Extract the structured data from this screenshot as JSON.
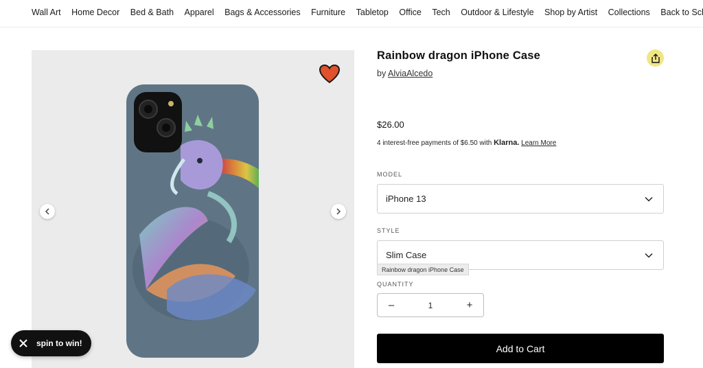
{
  "nav": {
    "items": [
      "Wall Art",
      "Home Decor",
      "Bed & Bath",
      "Apparel",
      "Bags & Accessories",
      "Furniture",
      "Tabletop",
      "Office",
      "Tech",
      "Outdoor & Lifestyle",
      "Shop by Artist",
      "Collections",
      "Back to School"
    ]
  },
  "product": {
    "title": "Rainbow dragon iPhone Case",
    "by_prefix": "by",
    "artist": "AlviaAlcedo",
    "price": "$26.00",
    "klarna_text": "4 interest-free payments of $6.50 with",
    "klarna_brand": "Klarna.",
    "klarna_link": "Learn More"
  },
  "options": {
    "model_label": "MODEL",
    "model_value": "iPhone 13",
    "style_label": "STYLE",
    "style_value": "Slim Case",
    "tooltip": "Rainbow dragon iPhone Case",
    "quantity_label": "QUANTITY",
    "quantity": "1",
    "minus": "–",
    "plus": "+"
  },
  "actions": {
    "add_to_cart": "Add to Cart",
    "spin": "spin to win!"
  },
  "icons": {
    "favorite": "heart-icon",
    "share": "share-icon",
    "prev": "chevron-left-icon",
    "next": "chevron-right-icon",
    "close": "close-icon",
    "dropdown": "chevron-down-icon"
  },
  "colors": {
    "heart": "#e0522b",
    "share_bg": "#efe684",
    "cart_bg": "#000000",
    "case": "#5f7585"
  }
}
